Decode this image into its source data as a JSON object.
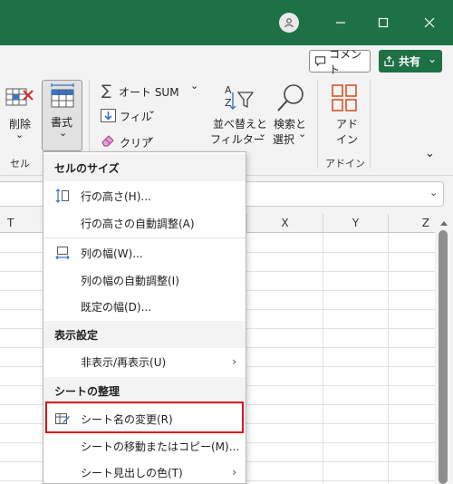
{
  "titlebar": {
    "icons": [
      "user-icon",
      "minimize-icon",
      "maximize-icon",
      "close-icon"
    ]
  },
  "share_row": {
    "comment_label": "コメント",
    "share_label": "共有",
    "share_chevron": "⌄"
  },
  "ribbon": {
    "delete_label": "削除",
    "delete_chevron": "⌄",
    "format_label": "書式",
    "format_chevron": "⌄",
    "cells_group": "セル",
    "autosum_label": "オート SUM",
    "autosum_chevron": "⌄",
    "fill_label": "フィル",
    "fill_chevron": "⌄",
    "clear_label": "クリア",
    "clear_chevron": "⌄",
    "sort_label_1": "並べ替えと",
    "sort_label_2": "フィルター",
    "sort_chevron": "⌄",
    "find_label_1": "検索と",
    "find_label_2": "選択",
    "find_chevron": "⌄",
    "addin_label_1": "アド",
    "addin_label_2": "イン",
    "addin_group": "アドイン",
    "collapse_chevron": "⌄"
  },
  "formula_bar": {
    "chevron": "⌄"
  },
  "grid": {
    "columns": [
      "T",
      "X",
      "Y",
      "Z"
    ]
  },
  "menu": {
    "section_cell_size": "セルのサイズ",
    "row_height": "行の高さ(H)...",
    "row_autofit": "行の高さの自動調整(A)",
    "col_width": "列の幅(W)...",
    "col_autofit": "列の幅の自動調整(I)",
    "default_width": "既定の幅(D)...",
    "section_visibility": "表示設定",
    "hide_unhide": "非表示/再表示(U)",
    "section_organize": "シートの整理",
    "rename_sheet": "シート名の変更(R)",
    "move_copy": "シートの移動またはコピー(M)...",
    "tab_color": "シート見出しの色(T)",
    "submenu_arrow": "›"
  },
  "colors": {
    "excel_green": "#1e7145",
    "highlight_red": "#e0101a",
    "addin_orange": "#d9542b"
  }
}
